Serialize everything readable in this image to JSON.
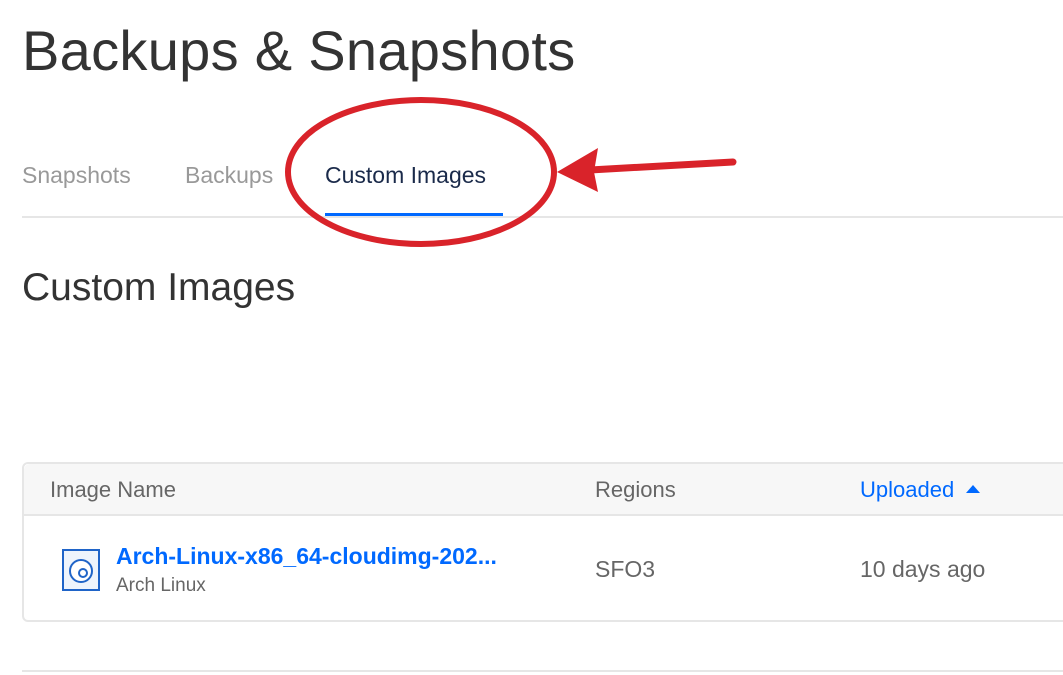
{
  "page": {
    "title": "Backups & Snapshots"
  },
  "tabs": [
    {
      "label": "Snapshots",
      "active": false
    },
    {
      "label": "Backups",
      "active": false
    },
    {
      "label": "Custom Images",
      "active": true
    }
  ],
  "section": {
    "title": "Custom Images"
  },
  "table": {
    "columns": [
      {
        "label": "Image Name"
      },
      {
        "label": "Regions"
      },
      {
        "label": "Uploaded",
        "sorted": "ascending"
      }
    ],
    "rows": [
      {
        "name": "Arch-Linux-x86_64-cloudimg-202...",
        "distribution": "Arch Linux",
        "region": "SFO3",
        "uploaded": "10 days ago",
        "icon": "disk-image-icon"
      }
    ]
  },
  "annotation": {
    "color": "#d9232a",
    "highlighted_tab": "Custom Images"
  },
  "colors": {
    "accent": "#0069ff",
    "text_primary": "#333333",
    "text_muted": "#999999"
  }
}
